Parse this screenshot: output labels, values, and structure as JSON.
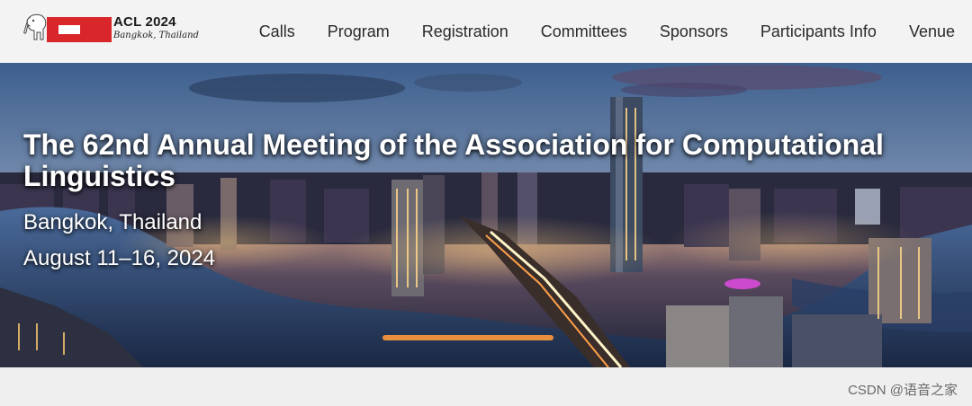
{
  "logo": {
    "name": "ACL 2024",
    "subtitle": "Bangkok, Thailand",
    "elephant_icon": "elephant-icon"
  },
  "nav": {
    "items": [
      {
        "label": "Calls"
      },
      {
        "label": "Program"
      },
      {
        "label": "Registration"
      },
      {
        "label": "Committees"
      },
      {
        "label": "Sponsors"
      },
      {
        "label": "Participants Info"
      },
      {
        "label": "Venue"
      }
    ]
  },
  "hero": {
    "title": "The 62nd Annual Meeting of the Association for Computational Linguistics",
    "location": "Bangkok, Thailand",
    "dates": "August 11–16, 2024",
    "image": "bangkok-skyline-night"
  },
  "watermark": "CSDN @语音之家",
  "colors": {
    "brand_red": "#d9262b",
    "navbar_bg": "#f3f3f3",
    "nav_text": "#2a2a2a",
    "hero_text": "#ffffff"
  }
}
